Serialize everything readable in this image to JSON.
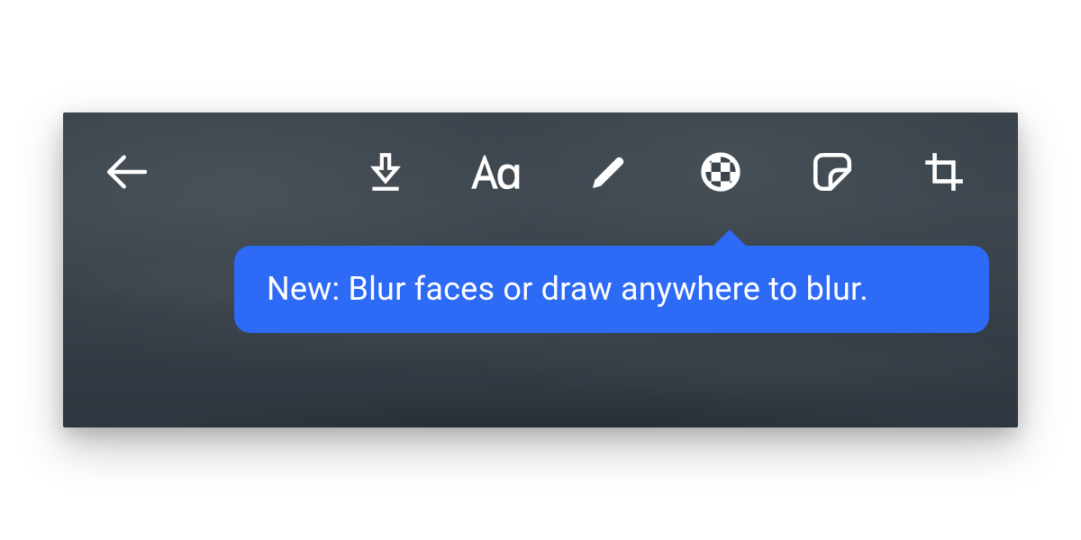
{
  "tooltip": {
    "text": "New: Blur faces or draw anywhere to blur."
  },
  "icons": {
    "back": "back-arrow",
    "save": "download",
    "text": "text-Aa",
    "draw": "pen",
    "blur": "checker-circle",
    "sticker": "sticker",
    "crop": "crop"
  },
  "colors": {
    "tooltip_bg": "#2D6AF6",
    "icon": "#FFFFFF"
  }
}
